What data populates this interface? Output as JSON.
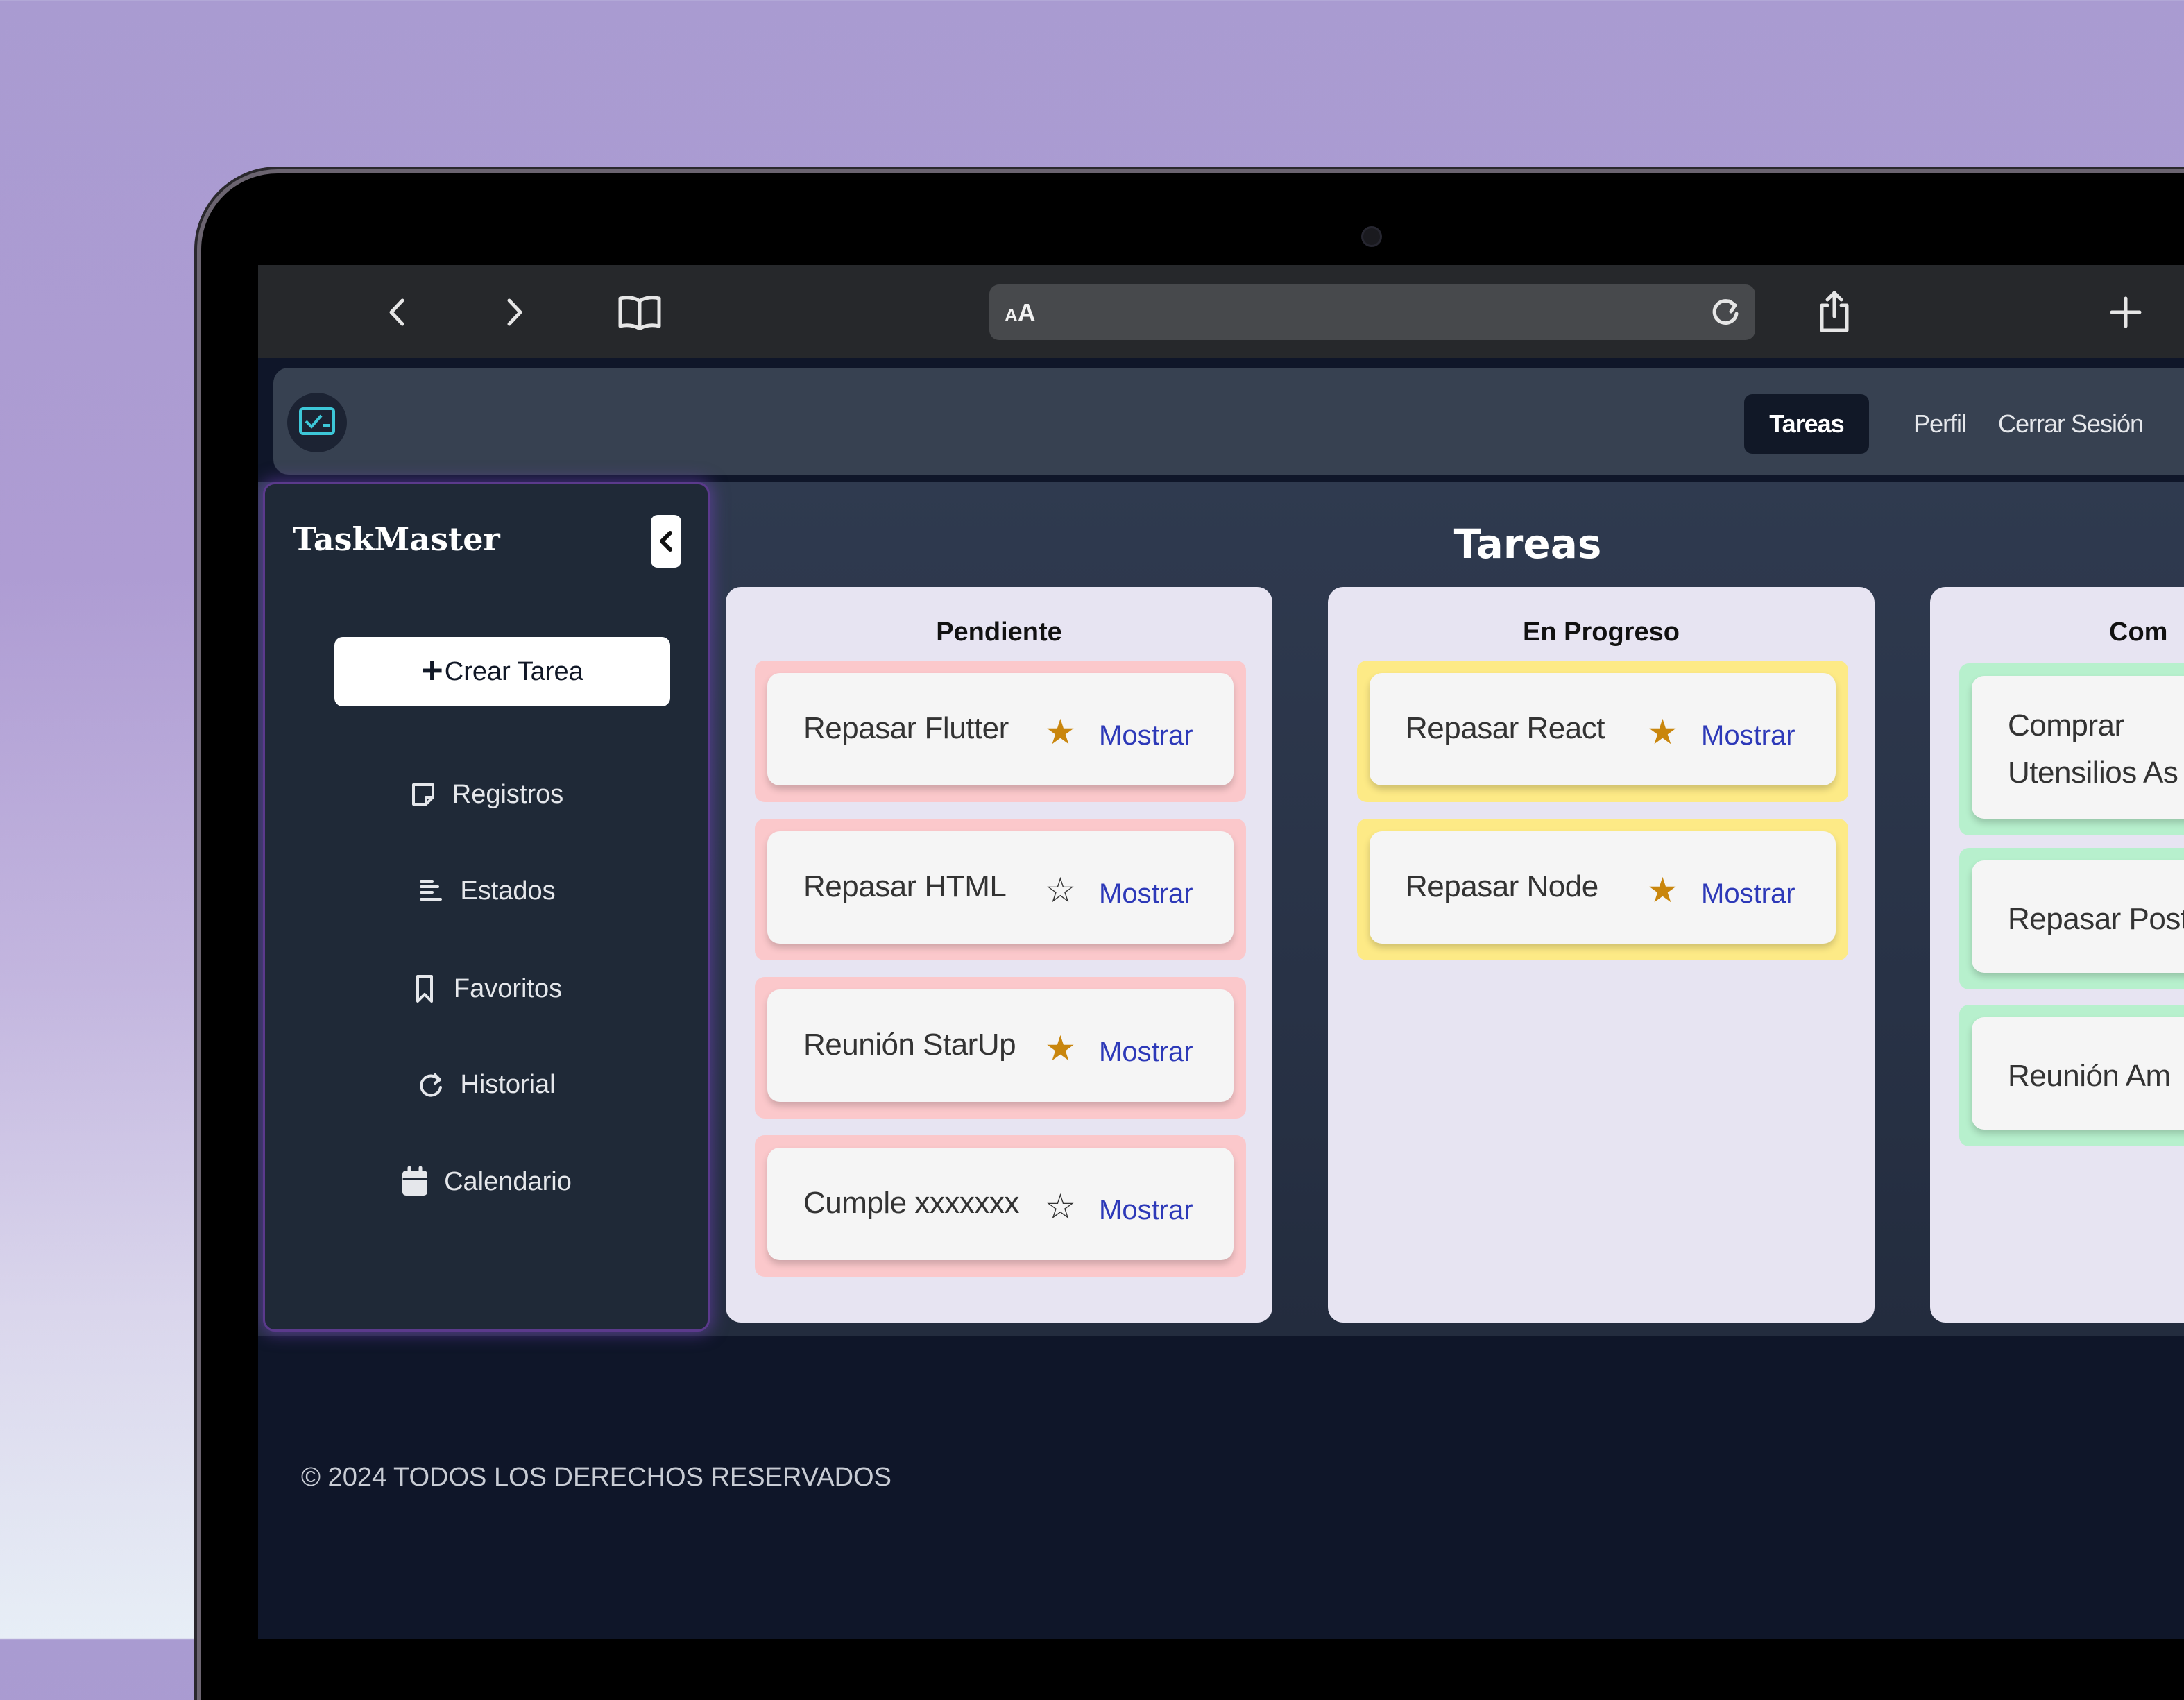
{
  "browser": {
    "address_text": "AA"
  },
  "navbar": {
    "links": [
      "Tareas",
      "Perfil",
      "Cerrar Sesión"
    ]
  },
  "sidebar": {
    "brand": "TaskMaster",
    "create_button": "Crear Tarea",
    "items": [
      {
        "label": "Registros",
        "icon": "note-icon"
      },
      {
        "label": "Estados",
        "icon": "list-icon"
      },
      {
        "label": "Favoritos",
        "icon": "bookmark-icon"
      },
      {
        "label": "Historial",
        "icon": "refresh-icon"
      },
      {
        "label": "Calendario",
        "icon": "calendar-icon"
      }
    ]
  },
  "main": {
    "title": "Tareas",
    "columns": [
      {
        "title": "Pendiente",
        "color": "#fbc8cb",
        "cards": [
          {
            "title": "Repasar Flutter",
            "favorite": true,
            "action": "Mostrar"
          },
          {
            "title": "Repasar HTML",
            "favorite": false,
            "action": "Mostrar"
          },
          {
            "title": "Reunión StarUp",
            "favorite": true,
            "action": "Mostrar"
          },
          {
            "title": "Cumple xxxxxxx",
            "favorite": false,
            "action": "Mostrar"
          }
        ]
      },
      {
        "title": "En Progreso",
        "color": "#fdea86",
        "cards": [
          {
            "title": "Repasar React",
            "favorite": true,
            "action": "Mostrar"
          },
          {
            "title": "Repasar Node",
            "favorite": true,
            "action": "Mostrar"
          }
        ]
      },
      {
        "title": "Com",
        "color": "#b7f0cd",
        "cards": [
          {
            "title_line1": "Comprar",
            "title_line2": "Utensilios As"
          },
          {
            "title": "Repasar Post"
          },
          {
            "title": "Reunión Am"
          }
        ]
      }
    ]
  },
  "footer": {
    "text": "© 2024 TODOS LOS DERECHOS RESERVADOS"
  },
  "colors": {
    "accent_star": "#c9860d",
    "link": "#2d39b8",
    "navbar": "#374151",
    "sidebar": "#1f2937"
  }
}
